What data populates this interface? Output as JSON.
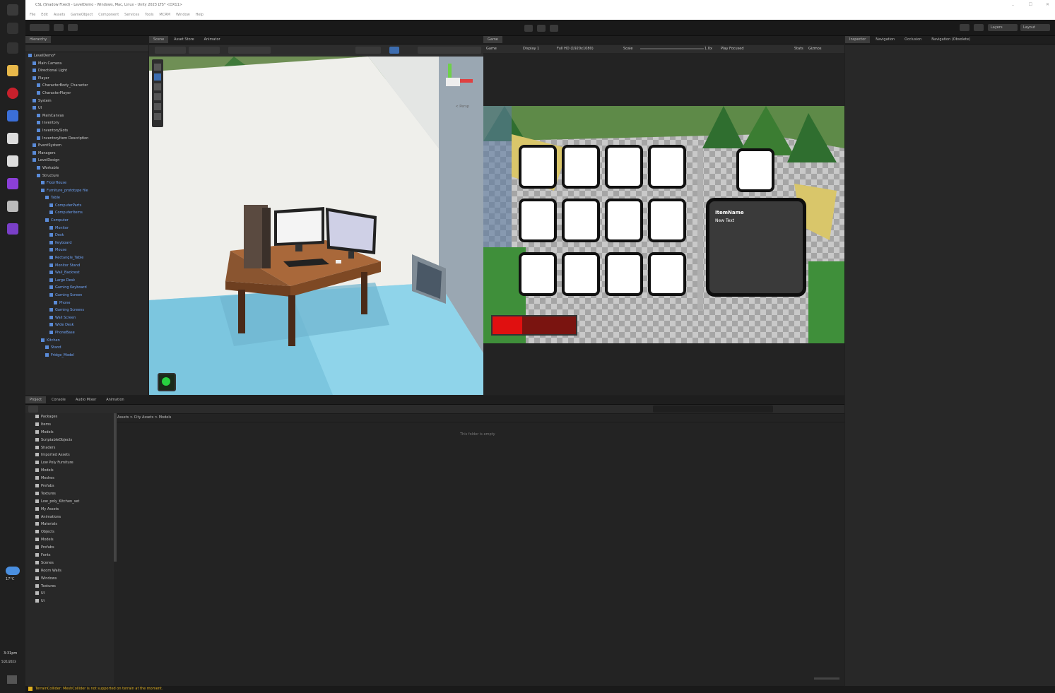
{
  "window": {
    "title": "CSL (Shadow Fixed) - LevelDemo - Windows, Mac, Linux - Unity 2023 LTS* <DX11>",
    "menu": [
      "File",
      "Edit",
      "Assets",
      "GameObject",
      "Component",
      "Services",
      "Tools",
      "MCRM",
      "Window",
      "Help"
    ]
  },
  "toolbar": {
    "layers_label": "Layers",
    "layout_label": "Layout"
  },
  "hierarchy": {
    "tab": "Hierarchy",
    "items": [
      "LevelDemo*",
      "Main Camera",
      "Directional Light",
      "Player",
      "CharacterBody_Character",
      "CharacterPlayer",
      "System",
      "UI",
      "MainCanvas",
      "Inventory",
      "InventorySlots",
      "InventoryItem Description",
      "EventSystem",
      "Managers",
      "LevelDesign",
      "Workable",
      "Structure",
      "FloorHouse",
      "Furniture_prototype file",
      "Table",
      "ComputerParts",
      "ComputerItems",
      "Computer",
      "Monitor",
      "Desk",
      "Keyboard",
      "Mouse",
      "Rectangle_Table",
      "Monitor Stand",
      "Wall_Backrest",
      "Large Desk",
      "Gaming Keyboard",
      "Gaming Screen",
      "Phone",
      "Gaming Screens",
      "Wall Screen",
      "Wide Desk",
      "PhoneBase",
      "Kitchen",
      "Stand",
      "Fridge_Model"
    ]
  },
  "scene": {
    "tabs": [
      "Scene",
      "Asset Store",
      "Animator"
    ],
    "persp_label": "< Persp"
  },
  "game": {
    "tab": "Game",
    "controls": [
      "Game",
      "Display 1",
      "Full HD (1920x1080)",
      "Scale",
      "1.0x",
      "Play Focused",
      "Stats",
      "Gizmos"
    ],
    "tooltip_title": "ItemName",
    "tooltip_text": "New Text",
    "health_fraction": 0.36,
    "slot_rows": 3,
    "slot_cols": 4
  },
  "inspector": {
    "tabs": [
      "Inspector",
      "Navigation",
      "Occlusion",
      "Navigation (Obsolete)"
    ]
  },
  "project": {
    "tabs": [
      "Project",
      "Console",
      "Audio Mixer",
      "Animation"
    ],
    "breadcrumb": [
      "Assets",
      "City Assets",
      "Models"
    ],
    "empty_message": "This folder is empty",
    "folders": [
      "Packages",
      "Items",
      "Models",
      "ScriptableObjects",
      "Shaders",
      "Imported Assets",
      "Low Poly Furniture",
      "Models",
      "Meshes",
      "Prefabs",
      "Textures",
      "Low_poly_Kitchen_set",
      "My Assets",
      "Animations",
      "Materials",
      "Objects",
      "Models",
      "Prefabs",
      "Fonts",
      "Scenes",
      "Room Walls",
      "Windows",
      "Textures",
      "UI",
      "Ui"
    ]
  },
  "status": {
    "message": "TerrainCollider: MeshCollider is not supported on terrain at the moment."
  },
  "taskbar": {
    "temp": "17°C",
    "time": "3:31pm",
    "date": "5/21/2023"
  },
  "colors": {
    "unity_bg": "#282828",
    "scene_floor": "#8fd4ea",
    "health_fill": "#e01010",
    "health_bg": "#7a1410"
  }
}
